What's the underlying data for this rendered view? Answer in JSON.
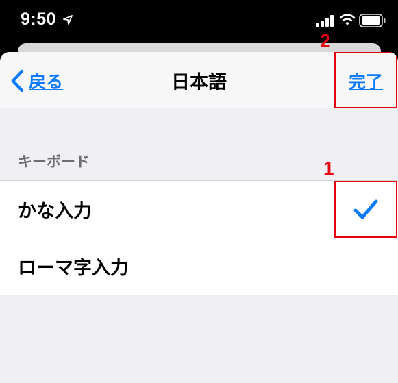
{
  "status_bar": {
    "time": "9:50"
  },
  "nav": {
    "back_label": "戻る",
    "title": "日本語",
    "done_label": "完了"
  },
  "section": {
    "header": "キーボード"
  },
  "list": {
    "items": [
      {
        "label": "かな入力",
        "selected": true
      },
      {
        "label": "ローマ字入力",
        "selected": false
      }
    ]
  },
  "annotations": {
    "step1": "1",
    "step2": "2"
  },
  "colors": {
    "accent": "#0a7aff",
    "highlight": "#e6000f"
  }
}
